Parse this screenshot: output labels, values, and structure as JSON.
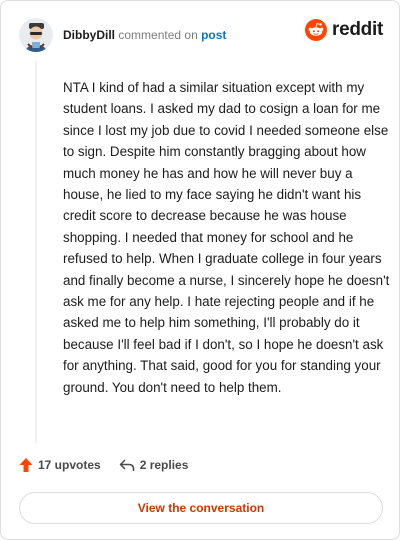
{
  "header": {
    "username": "DibbyDill",
    "action": "commented on",
    "post_link": "post",
    "brand": "reddit"
  },
  "colors": {
    "brand_orange": "#ff4500",
    "link_blue": "#0079d3",
    "cta_text": "#cc3700"
  },
  "comment": {
    "text": "NTA I kind of had a similar situation except with my student loans. I asked my dad to cosign a loan for me since I lost my job due to covid I needed someone else to sign. Despite him constantly bragging about how much money he has and how he will never buy a house, he lied to my face saying he didn't want his credit score to decrease because he was house shopping. I needed that money for school and he refused to help. When I graduate college in four years and finally become a nurse, I sincerely hope he doesn't ask me for any help. I hate rejecting people and if he asked me to help him something, I'll probably do it because I'll feel bad if I don't, so I hope he doesn't ask for anything. That said, good for you for standing your ground. You don't need to help them."
  },
  "actions": {
    "upvotes": "17 upvotes",
    "replies": "2 replies"
  },
  "cta": {
    "label": "View the conversation"
  },
  "icons": {
    "avatar": "avatar-icon",
    "brand": "reddit-logo-icon",
    "upvote": "upvote-arrow-icon",
    "reply": "reply-arrow-icon"
  }
}
